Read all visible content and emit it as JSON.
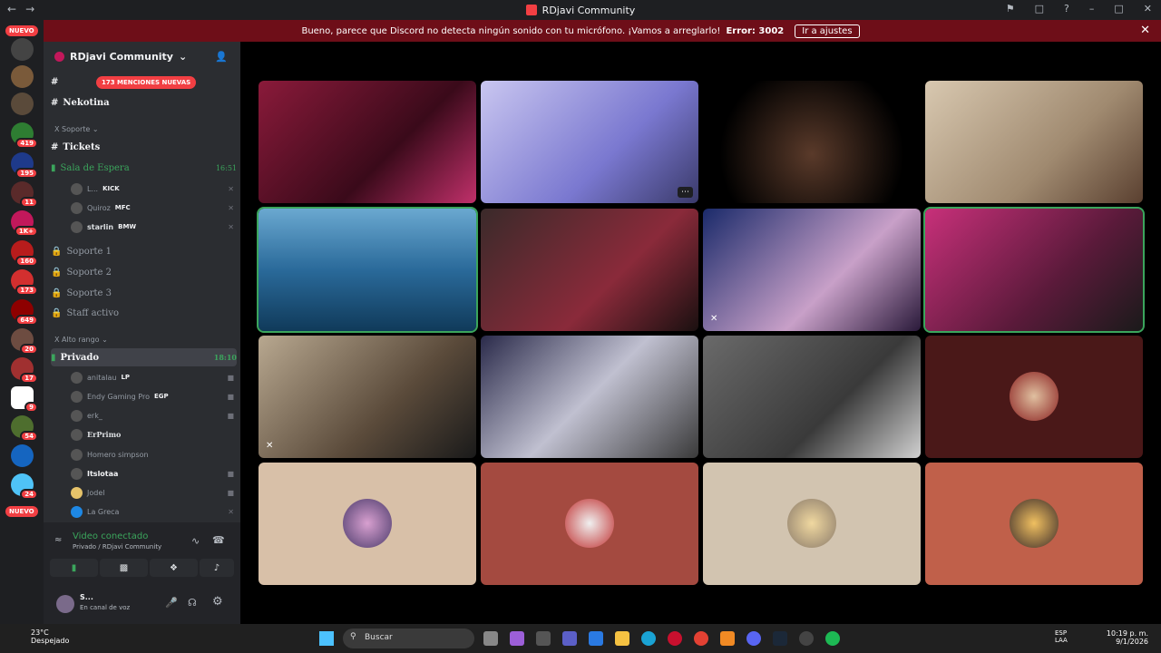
{
  "window": {
    "title": "RDjavi Community"
  },
  "banner": {
    "message": "Bueno, parece que Discord no detecta ningún sonido con tu micrófono. ¡Vamos a arreglarlo!",
    "error": "Error: 3002",
    "button": "Ir a ajustes"
  },
  "rail": {
    "nuevo_top": "NUEVO",
    "nuevo_bottom": "NUEVO",
    "badges": [
      "419",
      "195",
      "11",
      "1K+",
      "160",
      "173",
      "649",
      "20",
      "17",
      "9",
      "54",
      "24"
    ]
  },
  "server": {
    "name": "RDjavi Community",
    "mentions": "173 MENCIONES NUEVAS"
  },
  "channels": {
    "nekotina": "Nekotina",
    "soporte_cat": "Soporte",
    "tickets": "Tickets",
    "sala": "Sala de Espera",
    "sala_time": "16:51",
    "soporte1": "Soporte 1",
    "soporte2": "Soporte 2",
    "soporte3": "Soporte 3",
    "staff": "Staff activo",
    "alto_cat": "Alto rango",
    "privado": "Privado",
    "privado_time": "18:10"
  },
  "sala_users": [
    {
      "name": "L...",
      "tag": "KICK"
    },
    {
      "name": "Quiroz",
      "tag": "MFC"
    },
    {
      "name": "starlin",
      "tag": "BMW"
    }
  ],
  "privado_users": [
    {
      "name": "anitalau",
      "tag": "LP"
    },
    {
      "name": "Endy Gaming Pro",
      "tag": "EGP"
    },
    {
      "name": "erk_",
      "tag": ""
    },
    {
      "name": "ErPrimo",
      "tag": ""
    },
    {
      "name": "Homero simpson",
      "tag": ""
    },
    {
      "name": "Itslotaa",
      "tag": ""
    },
    {
      "name": "Jodel",
      "tag": ""
    },
    {
      "name": "La Greca",
      "tag": ""
    }
  ],
  "voice": {
    "status": "Video conectado",
    "where": "Privado / RDjavi Community",
    "user": "S...",
    "user_state": "En canal de voz"
  },
  "taskbar": {
    "temp": "23°C",
    "weather": "Despejado",
    "search": "Buscar",
    "lang1": "ESP",
    "lang2": "LAA",
    "time": "10:19 p. m.",
    "date": "9/1/2026"
  },
  "colors": {
    "accent_red": "#f23f43",
    "green": "#3ba55c",
    "banner": "#6e0e18"
  }
}
